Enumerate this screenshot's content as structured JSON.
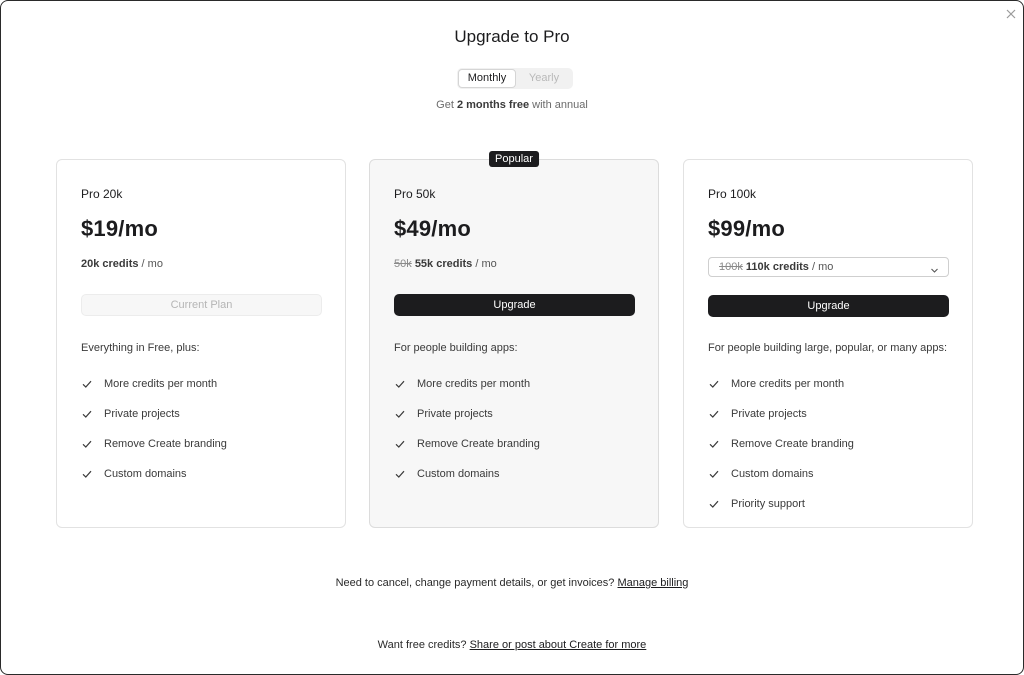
{
  "modal": {
    "title": "Upgrade to Pro",
    "close_icon": "close-icon"
  },
  "billing_toggle": {
    "monthly": "Monthly",
    "yearly": "Yearly",
    "selected": "Monthly"
  },
  "promo": {
    "prefix": "Get",
    "highlight": "2 months free",
    "suffix": "with annual"
  },
  "plans": [
    {
      "name": "Pro 20k",
      "price": "$19/mo",
      "credits_strong": "20k credits",
      "credits_unit": "/ mo",
      "button": "Current Plan",
      "lead": "Everything in Free, plus:",
      "features": [
        "More credits per month",
        "Private projects",
        "Remove Create branding",
        "Custom domains"
      ]
    },
    {
      "name": "Pro 50k",
      "badge": "Popular",
      "price": "$49/mo",
      "credits_old": "50k",
      "credits_strong": "55k credits",
      "credits_unit": "/ mo",
      "button": "Upgrade",
      "lead": "For people building apps:",
      "features": [
        "More credits per month",
        "Private projects",
        "Remove Create branding",
        "Custom domains"
      ]
    },
    {
      "name": "Pro 100k",
      "price": "$99/mo",
      "credits_old": "100k",
      "credits_strong": "110k credits",
      "credits_unit": "/ mo",
      "button": "Upgrade",
      "lead": "For people building large, popular, or many apps:",
      "features": [
        "More credits per month",
        "Private projects",
        "Remove Create branding",
        "Custom domains",
        "Priority support"
      ]
    }
  ],
  "footer": {
    "billing_text": "Need to cancel, change payment details, or get invoices?",
    "billing_link": "Manage billing",
    "credits_text": "Want free credits?",
    "credits_link": "Share or post about Create for more"
  },
  "colors": {
    "primary": "#1c1c1e",
    "popular_bg": "#f7f7f7",
    "border": "#e2e2e2"
  }
}
